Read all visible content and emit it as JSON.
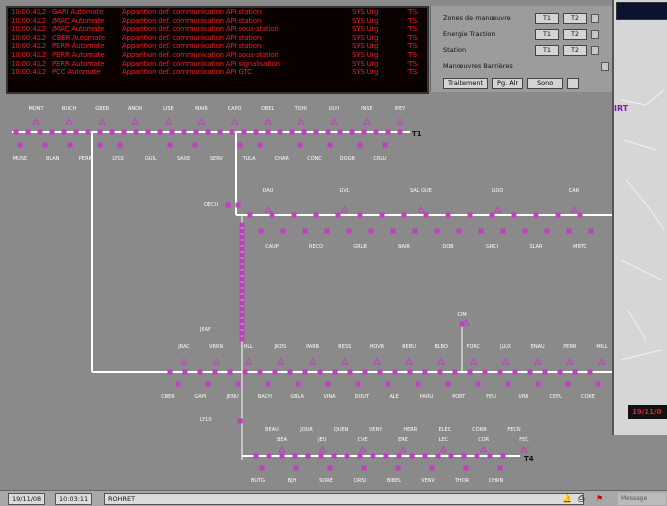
{
  "alarms": [
    {
      "time": "10:00:42",
      "level": "L2",
      "source": "GARI Automate",
      "message": "Apparition def. communication API station",
      "system": "SYS Urg",
      "code": "'TS"
    },
    {
      "time": "10:00:42",
      "level": "L2",
      "source": "/MAC Automate",
      "message": "Apparition def. communication API station",
      "system": "SYS Urg",
      "code": "'TS"
    },
    {
      "time": "10:00:42",
      "level": "L2",
      "source": "/MAC Automate",
      "message": "Apparition def. communication API sous-station",
      "system": "SYS Urg",
      "code": "'TS"
    },
    {
      "time": "10:00:42",
      "level": "L2",
      "source": "CBER Automate",
      "message": "Apparition def. communication API station",
      "system": "SYS Urg",
      "code": "'TS"
    },
    {
      "time": "10:00:42",
      "level": "L2",
      "source": "PERR Automate",
      "message": "Apparition def. communication API station",
      "system": "SYS Urg",
      "code": "'TS"
    },
    {
      "time": "10:00:42",
      "level": "L2",
      "source": "PERR Automate",
      "message": "Apparition def. communication API sous-station",
      "system": "SYS Urg",
      "code": "'TS"
    },
    {
      "time": "10:00:42",
      "level": "L2",
      "source": "PERR Automate",
      "message": "Apparition def. communication API signalisation",
      "system": "SYS Urg",
      "code": "'TS"
    },
    {
      "time": "10:00:42",
      "level": "L2",
      "source": "PCC Automate",
      "message": "Apparition def. communication API GTC",
      "system": "SYS Urg",
      "code": "'TS"
    }
  ],
  "controls": {
    "zones_label": "Zones de manœuvre",
    "energie_label": "Energie Traction",
    "station_label": "Station",
    "barrieres_label": "Manœuvres Barrières",
    "t1": "T1",
    "t2": "T2",
    "traitement": "Traitement",
    "pg_alr": "Pg. Alr",
    "sono": "Sono"
  },
  "network": {
    "track_t1": "T1",
    "track_t4": "T4",
    "t1_top": [
      "MONT",
      "BUCH",
      "GBER",
      "ANDR",
      "LISE",
      "MAIR",
      "CAPO",
      "OBEL",
      "TOHI",
      "ULYI",
      "INSE",
      "IPEY"
    ],
    "t1_bottom": [
      "MUSE",
      "BLAN",
      "PERR",
      "LY02",
      "GUIL",
      "SAXE",
      "SERV",
      "TULA",
      "CHAR",
      "CONC",
      "DOGB",
      "CRLU"
    ],
    "line2_top": [
      "DAU",
      "GVL",
      "SAL GUE",
      "GOO",
      "CAR"
    ],
    "line2_bottom": [
      "CAUP",
      "RECO",
      "GRLB",
      "BAIR",
      "DOB",
      "GRCI",
      "SLAR",
      "MRTC"
    ],
    "line3_top": [
      "JRAC",
      "VRRN",
      "HLL",
      "JKDS",
      "PARB",
      "RESS",
      "HOVR",
      "REBU",
      "BLBO",
      "FORC",
      "JLUX",
      "ENAU",
      "PERR",
      "MILL"
    ],
    "line3_bottom": [
      "CBER",
      "GAPI",
      "JENU",
      "BACH",
      "GBLA",
      "VINA",
      "DOUT",
      "ALE",
      "PARU",
      "PORT",
      "FEU",
      "VINI",
      "CEPL",
      "CORE"
    ],
    "t4_top": [
      "BEAU",
      "JOUR",
      "QUEN",
      "VENY",
      "HERR",
      "ELEC",
      "CORB",
      "FECN"
    ],
    "t4_top2": [
      "BEA",
      "JEU",
      "CVE",
      "ERE",
      "LEC",
      "COR",
      "FEC"
    ],
    "t4_bottom": [
      "BUTG",
      "BJH",
      "SORE",
      "DRSI",
      "BIBEL",
      "VENV",
      "THOR",
      "CHRN"
    ],
    "junction_labels": [
      "OECU",
      "JEAF",
      "LY10"
    ],
    "branch_label": "CIM"
  },
  "right_window": {
    "logo": "IRT",
    "badge": "19/11/0"
  },
  "status_bar": {
    "date": "19/11/08",
    "time": "10:03:11",
    "user": "ROHRET",
    "message": "Message"
  },
  "colors": {
    "alarm_text": "#e8201a",
    "station": "#c03fc0",
    "track": "#ffffff",
    "background": "#8a8a8a"
  }
}
